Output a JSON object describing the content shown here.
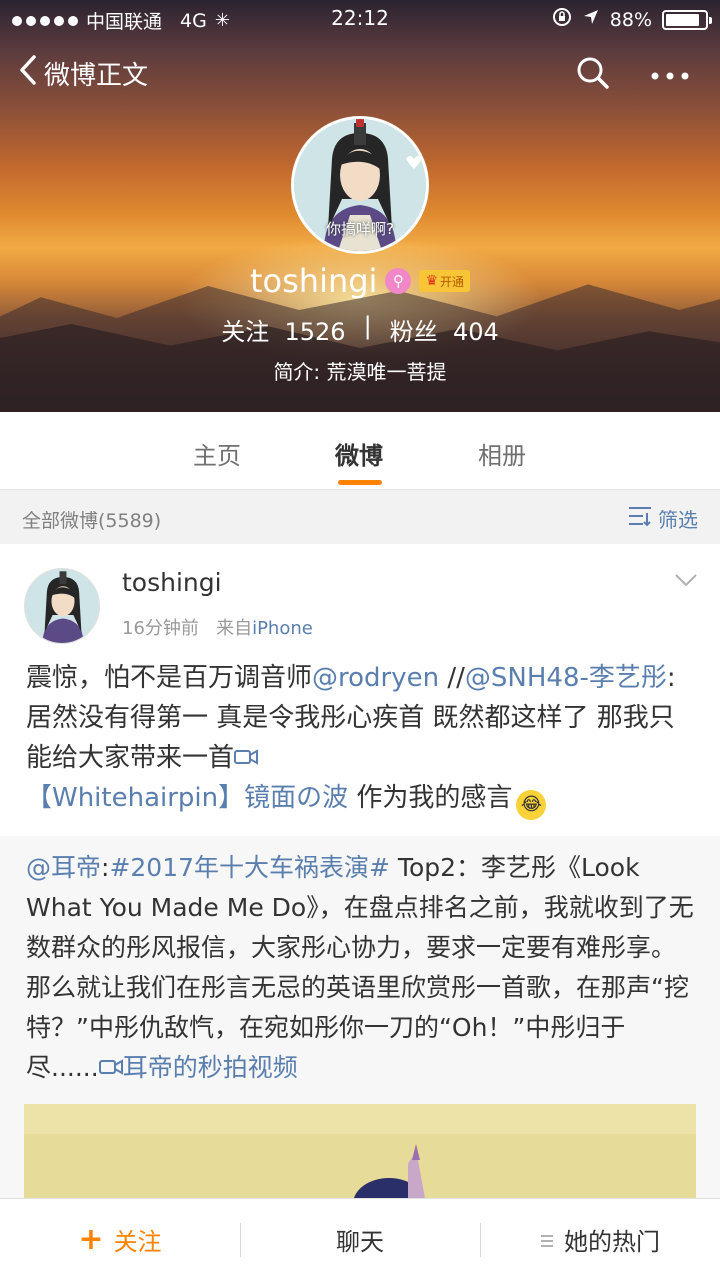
{
  "status_bar": {
    "carrier": "中国联通",
    "network": "4G",
    "time": "22:12",
    "battery_percent": "88%",
    "battery_level": 0.88
  },
  "navbar": {
    "back_label": "微博正文",
    "icons": [
      "search-icon",
      "more-icon"
    ]
  },
  "profile": {
    "avatar_caption": "你搞咩啊?",
    "username": "toshingi",
    "vip_label": "开通",
    "following_label": "关注",
    "following_count": "1526",
    "separator": "|",
    "followers_label": "粉丝",
    "followers_count": "404",
    "bio": "简介: 荒漠唯一菩提"
  },
  "tabs": [
    {
      "label": "主页"
    },
    {
      "label": "微博"
    },
    {
      "label": "相册"
    }
  ],
  "filter": {
    "count_label": "全部微博(5589)",
    "filter_label": "筛选"
  },
  "post": {
    "author": "toshingi",
    "time": "16分钟前",
    "source_prefix": "来自",
    "source": "iPhone",
    "text_1": "震惊，怕不是百万调音师",
    "mention_1": "@rodryen",
    "text_2": " //",
    "mention_2": "@SNH48-李艺彤",
    "text_3": ":居然没有得第一   真是令我彤心疾首  既然都这样了 那我只能给大家带来一首",
    "link_title": "【Whitehairpin】镜面の波",
    "text_4": " 作为我的感言",
    "repost": {
      "mention": "@耳帝",
      "colon": ":",
      "hashtag": "#2017年十大车祸表演#",
      "body": " Top2：李艺彤《Look What You Made Me Do》，在盘点排名之前，我就收到了无数群众的彤风报信，大家彤心协力，要求一定要有难彤享。那么就让我们在彤言无忌的英语里欣赏彤一首歌，在那声“挖特？”中彤仇敌忾，在宛如彤你一刀的“Oh！”中彤归于尽......",
      "video_link": "耳帝的秒拍视频"
    }
  },
  "bottom_bar": {
    "follow": "关注",
    "chat": "聊天",
    "hot": "她的热门"
  }
}
